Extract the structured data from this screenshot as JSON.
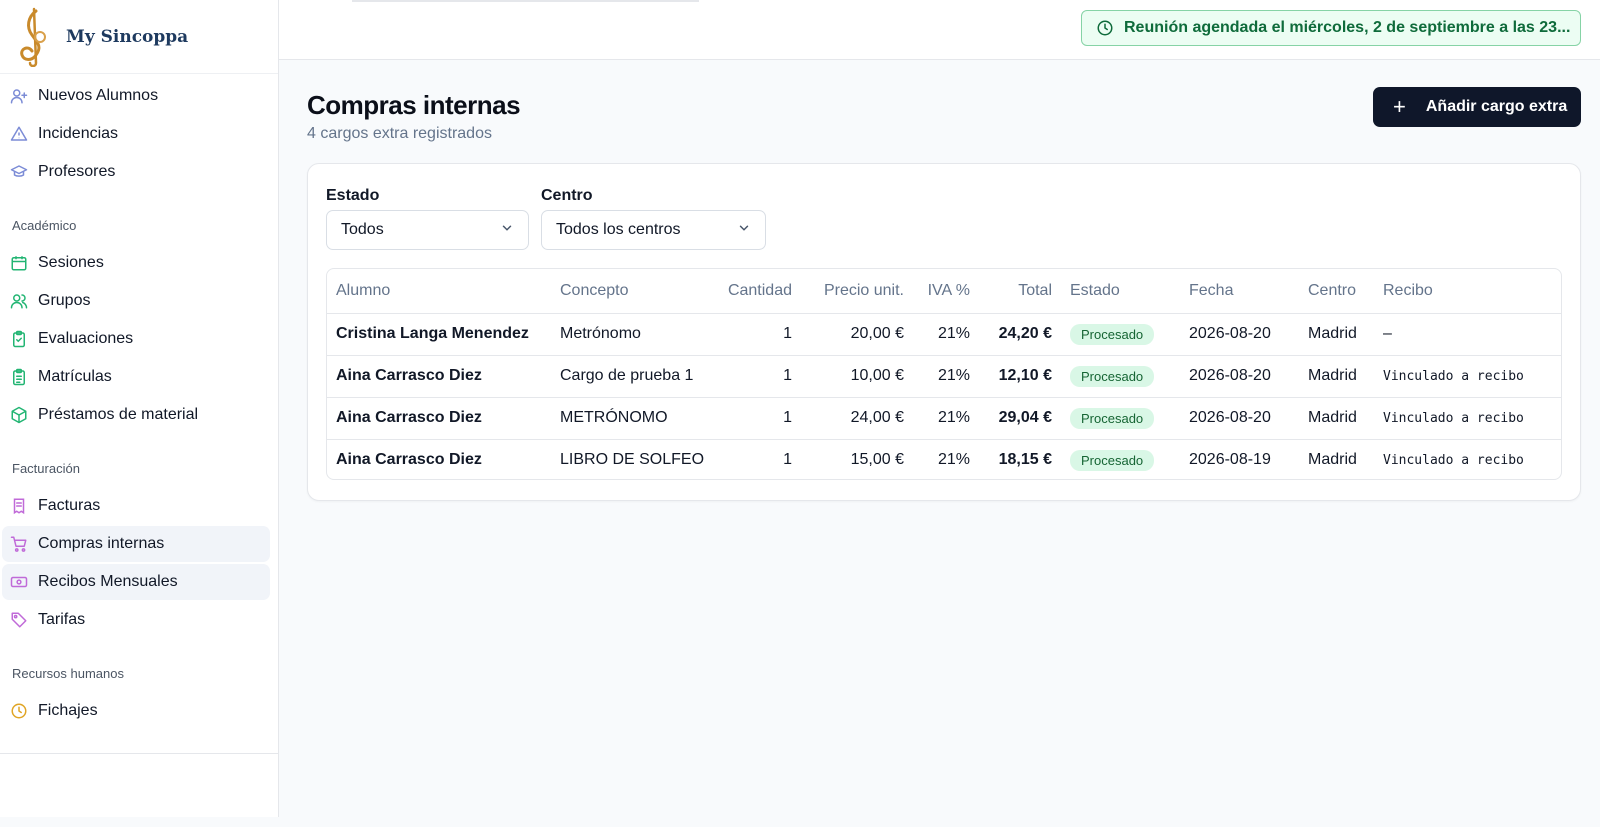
{
  "brand": {
    "name": "My Sincoppa"
  },
  "sidebar": {
    "top_items": [
      {
        "label": "Nuevos Alumnos",
        "icon": "user-plus-icon"
      },
      {
        "label": "Incidencias",
        "icon": "warning-triangle-icon"
      },
      {
        "label": "Profesores",
        "icon": "graduation-cap-icon"
      }
    ],
    "sections": [
      {
        "title": "Académico",
        "items": [
          {
            "label": "Sesiones",
            "icon": "calendar-icon"
          },
          {
            "label": "Grupos",
            "icon": "users-icon"
          },
          {
            "label": "Evaluaciones",
            "icon": "clipboard-check-icon"
          },
          {
            "label": "Matrículas",
            "icon": "clipboard-list-icon"
          },
          {
            "label": "Préstamos de material",
            "icon": "package-icon"
          }
        ]
      },
      {
        "title": "Facturación",
        "items": [
          {
            "label": "Facturas",
            "icon": "receipt-icon"
          },
          {
            "label": "Compras internas",
            "icon": "cart-icon"
          },
          {
            "label": "Recibos Mensuales",
            "icon": "banknote-icon"
          },
          {
            "label": "Tarifas",
            "icon": "tag-icon"
          }
        ]
      },
      {
        "title": "Recursos humanos",
        "items": [
          {
            "label": "Fichajes",
            "icon": "clock-icon"
          }
        ]
      }
    ]
  },
  "topbar": {
    "meeting_text": "Reunión agendada el miércoles, 2 de septiembre a las 23...",
    "meeting_icon": "clock-icon"
  },
  "main": {
    "title": "Compras internas",
    "subtitle": "4 cargos extra registrados",
    "add_button_label": "Añadir cargo extra"
  },
  "filters": {
    "estado": {
      "label": "Estado",
      "value": "Todos"
    },
    "centro": {
      "label": "Centro",
      "value": "Todos los centros"
    }
  },
  "table": {
    "columns": {
      "alumno": "Alumno",
      "concepto": "Concepto",
      "cantidad": "Cantidad",
      "precio": "Precio unit.",
      "iva": "IVA %",
      "total": "Total",
      "estado": "Estado",
      "fecha": "Fecha",
      "centro": "Centro",
      "recibo": "Recibo"
    },
    "rows": [
      {
        "alumno": "Cristina Langa Menendez",
        "concepto": "Metrónomo",
        "cantidad": "1",
        "precio": "20,00 €",
        "iva": "21%",
        "total": "24,20 €",
        "estado": "Procesado",
        "fecha": "2026-08-20",
        "centro": "Madrid",
        "recibo": "–"
      },
      {
        "alumno": "Aina Carrasco Diez",
        "concepto": "Cargo de prueba 1",
        "cantidad": "1",
        "precio": "10,00 €",
        "iva": "21%",
        "total": "12,10 €",
        "estado": "Procesado",
        "fecha": "2026-08-20",
        "centro": "Madrid",
        "recibo": "Vinculado a recibo"
      },
      {
        "alumno": "Aina Carrasco Diez",
        "concepto": "METRÓNOMO",
        "cantidad": "1",
        "precio": "24,00 €",
        "iva": "21%",
        "total": "29,04 €",
        "estado": "Procesado",
        "fecha": "2026-08-20",
        "centro": "Madrid",
        "recibo": "Vinculado a recibo"
      },
      {
        "alumno": "Aina Carrasco Diez",
        "concepto": "LIBRO DE SOLFEO",
        "cantidad": "1",
        "precio": "15,00 €",
        "iva": "21%",
        "total": "18,15 €",
        "estado": "Procesado",
        "fecha": "2026-08-19",
        "centro": "Madrid",
        "recibo": "Vinculado a recibo"
      }
    ]
  }
}
